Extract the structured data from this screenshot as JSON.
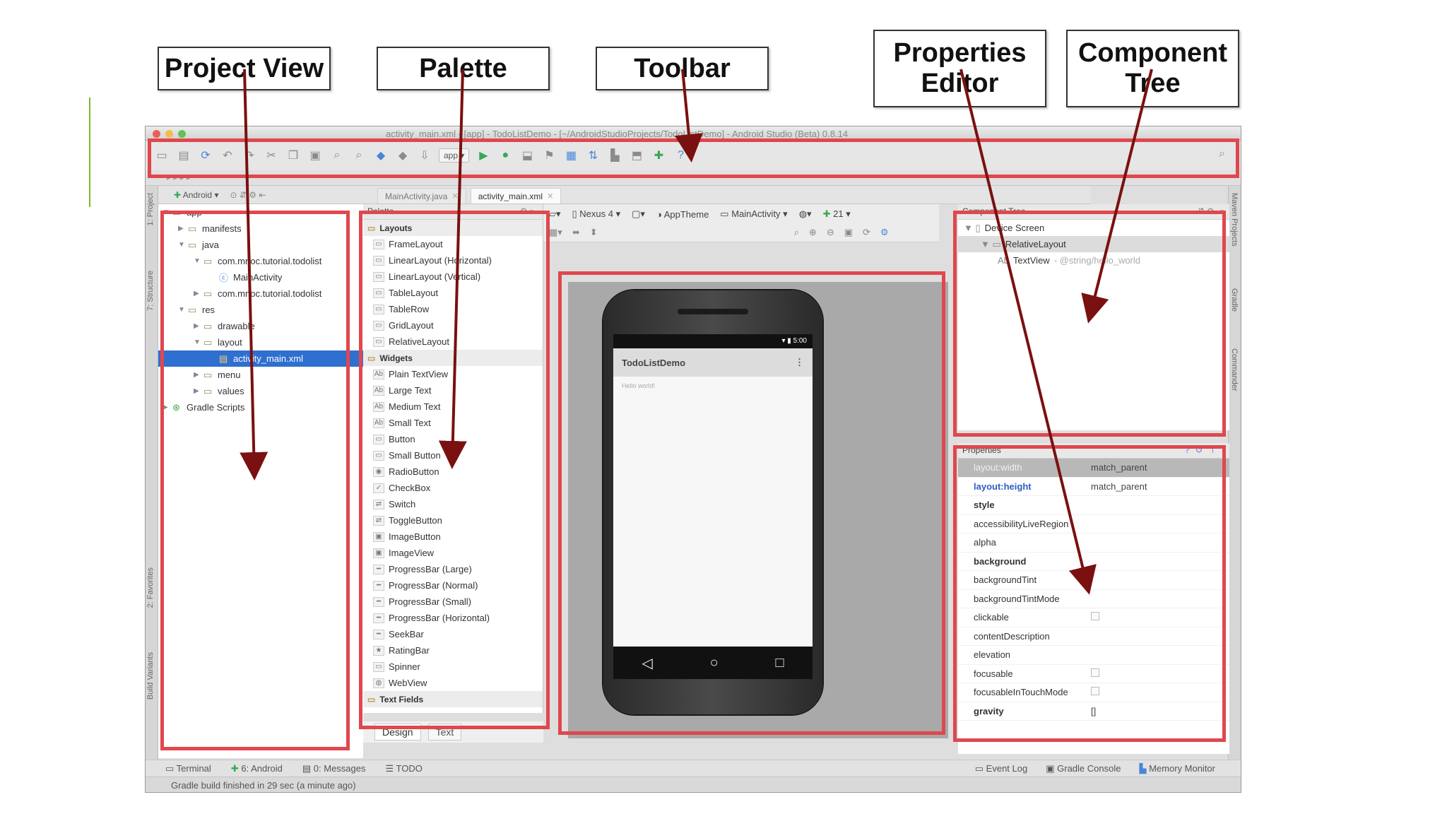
{
  "callouts": {
    "project_view": "Project View",
    "palette": "Palette",
    "toolbar": "Toolbar",
    "properties_editor_line1": "Properties",
    "properties_editor_line2": "Editor",
    "component_tree_line1": "Component",
    "component_tree_line2": "Tree"
  },
  "window": {
    "title": "activity_main.xml - [app] - TodoListDemo - [~/AndroidStudioProjects/TodoListDemo] - Android Studio (Beta) 0.8.14",
    "traffic_colors": [
      "#ec5f57",
      "#f4be4f",
      "#5fc454"
    ]
  },
  "toolbar": {
    "run_config": "app",
    "icons": [
      "open-icon",
      "save-icon",
      "sync-icon",
      "undo-icon",
      "redo-icon",
      "cut-icon",
      "copy-icon",
      "paste-icon",
      "find-icon",
      "replace-icon",
      "back-icon",
      "forward-icon",
      "make-icon",
      "run-icon",
      "debug-icon",
      "attach-icon",
      "coverage-icon",
      "profile-icon",
      "gradle-sync-icon",
      "avd-icon",
      "sdk-icon",
      "android-icon",
      "help-icon",
      "search-icon"
    ]
  },
  "project": {
    "view_selector": "Android",
    "tree": [
      {
        "label": "app",
        "level": 0,
        "expanded": true,
        "icon": "module-icon"
      },
      {
        "label": "manifests",
        "level": 1,
        "expanded": false,
        "icon": "folder-icon"
      },
      {
        "label": "java",
        "level": 1,
        "expanded": true,
        "icon": "folder-icon"
      },
      {
        "label": "com.mnoc.tutorial.todolist",
        "level": 2,
        "expanded": true,
        "icon": "package-icon"
      },
      {
        "label": "MainActivity",
        "level": 3,
        "expanded": null,
        "icon": "class-icon"
      },
      {
        "label": "com.mnoc.tutorial.todolist",
        "level": 2,
        "expanded": false,
        "icon": "package-icon"
      },
      {
        "label": "res",
        "level": 1,
        "expanded": true,
        "icon": "folder-icon"
      },
      {
        "label": "drawable",
        "level": 2,
        "expanded": false,
        "icon": "folder-icon"
      },
      {
        "label": "layout",
        "level": 2,
        "expanded": true,
        "icon": "folder-icon"
      },
      {
        "label": "activity_main.xml",
        "level": 3,
        "expanded": null,
        "icon": "xml-file-icon",
        "selected": true
      },
      {
        "label": "menu",
        "level": 2,
        "expanded": false,
        "icon": "folder-icon"
      },
      {
        "label": "values",
        "level": 2,
        "expanded": false,
        "icon": "folder-icon"
      },
      {
        "label": "Gradle Scripts",
        "level": 0,
        "expanded": false,
        "icon": "gradle-icon"
      }
    ]
  },
  "left_strip": {
    "project": "1: Project",
    "structure": "7: Structure",
    "favorites": "2: Favorites",
    "build_variants": "Build Variants"
  },
  "right_strip": {
    "maven": "Maven Projects",
    "gradle": "Gradle",
    "commander": "Commander"
  },
  "editor_tabs": [
    {
      "label": "MainActivity.java",
      "active": false
    },
    {
      "label": "activity_main.xml",
      "active": true
    }
  ],
  "palette": {
    "title": "Palette",
    "groups": [
      {
        "name": "Layouts",
        "items": [
          "FrameLayout",
          "LinearLayout (Horizontal)",
          "LinearLayout (Vertical)",
          "TableLayout",
          "TableRow",
          "GridLayout",
          "RelativeLayout"
        ]
      },
      {
        "name": "Widgets",
        "items": [
          "Plain TextView",
          "Large Text",
          "Medium Text",
          "Small Text",
          "Button",
          "Small Button",
          "RadioButton",
          "CheckBox",
          "Switch",
          "ToggleButton",
          "ImageButton",
          "ImageView",
          "ProgressBar (Large)",
          "ProgressBar (Normal)",
          "ProgressBar (Small)",
          "ProgressBar (Horizontal)",
          "SeekBar",
          "RatingBar",
          "Spinner",
          "WebView"
        ]
      },
      {
        "name": "Text Fields",
        "items": []
      }
    ]
  },
  "design_tabs": {
    "design": "Design",
    "text": "Text"
  },
  "design_toolbar": {
    "device": "Nexus 4",
    "theme": "AppTheme",
    "activity": "MainActivity",
    "api": "21"
  },
  "phone": {
    "app_title": "TodoListDemo",
    "status_time": "5:00",
    "hello_text": "Hello world!"
  },
  "component_tree": {
    "title": "Component Tree",
    "rows": [
      {
        "label": "Device Screen",
        "hint": "",
        "level": 0
      },
      {
        "label": "RelativeLayout",
        "hint": "",
        "level": 1,
        "selected": true
      },
      {
        "label": "TextView",
        "hint": "- @string/hello_world",
        "level": 2
      }
    ]
  },
  "properties": {
    "title": "Properties",
    "rows": [
      {
        "key": "layout:width",
        "value": "match_parent",
        "style": "hdr"
      },
      {
        "key": "layout:height",
        "value": "match_parent",
        "style": "blue"
      },
      {
        "key": "style",
        "value": "",
        "style": "bold"
      },
      {
        "key": "accessibilityLiveRegion",
        "value": "",
        "style": ""
      },
      {
        "key": "alpha",
        "value": "",
        "style": ""
      },
      {
        "key": "background",
        "value": "",
        "style": "bold"
      },
      {
        "key": "backgroundTint",
        "value": "",
        "style": ""
      },
      {
        "key": "backgroundTintMode",
        "value": "",
        "style": ""
      },
      {
        "key": "clickable",
        "value": "",
        "style": "",
        "checkbox": true
      },
      {
        "key": "contentDescription",
        "value": "",
        "style": ""
      },
      {
        "key": "elevation",
        "value": "",
        "style": ""
      },
      {
        "key": "focusable",
        "value": "",
        "style": "",
        "checkbox": true
      },
      {
        "key": "focusableInTouchMode",
        "value": "",
        "style": "",
        "checkbox": true
      },
      {
        "key": "gravity",
        "value": "[]",
        "style": "bold"
      }
    ]
  },
  "bottom_tools": {
    "left": [
      "Terminal",
      "6: Android",
      "0: Messages",
      "TODO"
    ],
    "right": [
      "Event Log",
      "Gradle Console",
      "Memory Monitor"
    ]
  },
  "status": {
    "text": "Gradle build finished in 29 sec (a minute ago)"
  },
  "colors": {
    "highlight": "#e0474e",
    "arrow": "#7a1010",
    "accent": "#7dbb2a"
  }
}
